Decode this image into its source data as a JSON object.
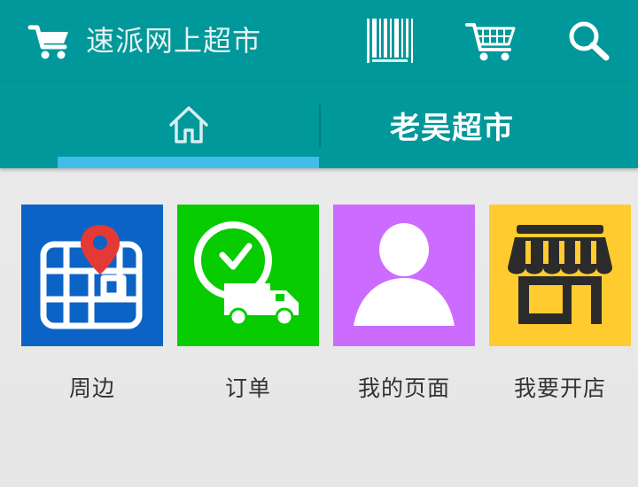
{
  "app": {
    "title": "速派网上超市"
  },
  "toolbar": {
    "barcode_icon": "barcode-icon",
    "cart_icon": "cart-icon",
    "search_icon": "search-icon"
  },
  "tabs": {
    "home_icon": "home-icon",
    "store_label": "老吴超市",
    "active": "home"
  },
  "tiles": [
    {
      "label": "周边",
      "icon": "map-pin-icon",
      "color": "#0b63c6"
    },
    {
      "label": "订单",
      "icon": "delivery-clock-icon",
      "color": "#06cc00"
    },
    {
      "label": "我的页面",
      "icon": "user-icon",
      "color": "#cc6cff"
    },
    {
      "label": "我要开店",
      "icon": "storefront-icon",
      "color": "#ffcb2e"
    }
  ],
  "colors": {
    "primary": "#00989a",
    "indicator": "#41bde8",
    "background": "#ececec"
  }
}
